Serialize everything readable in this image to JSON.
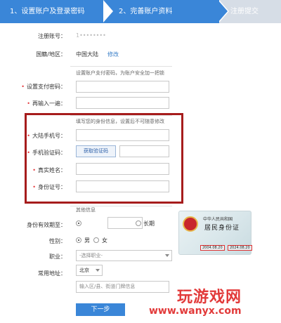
{
  "steps": {
    "step1": "1、设置账户及登录密码",
    "step2": "2、完善账户资料",
    "step3": "注册提交"
  },
  "account": {
    "label": "注册账号：",
    "value": "1••••••••",
    "region_label": "国籍/地区：",
    "region_value": "中国大陆",
    "region_link": "修改"
  },
  "pay_section": "设置账户支付密码，为账户安全加一把锁",
  "pay": {
    "password_label": "设置支付密码：",
    "confirm_label": "再输入一遍："
  },
  "identity_section": "填写您的身份信息，设置后不可随意修改",
  "identity": {
    "phone_label": "大陆手机号：",
    "sms_label": "手机验证码：",
    "sms_button": "获取验证码",
    "name_label": "真实姓名：",
    "id_label": "身份证号："
  },
  "other_section": "其他信息",
  "other": {
    "validity_label": "身份有效期至：",
    "longterm": "长期",
    "gender_label": "性别：",
    "male": "男",
    "female": "女",
    "job_label": "职业：",
    "job_placeholder": "-选择职业-",
    "address_label": "常用地址：",
    "city": "北京",
    "address_placeholder": "输入区/县、街道门牌信息"
  },
  "idcard": {
    "line1": "中华人民共和国",
    "line2": "居民身份证",
    "valid_from": "2004.08.20",
    "valid_to": "2024.08.20",
    "dash": "-"
  },
  "next_button": "下一步",
  "watermark": {
    "line1": "玩游戏网",
    "line2": "www.wanyx.com"
  },
  "colors": {
    "accent": "#3a86d8",
    "highlight_box": "#a61c1c",
    "required": "#e4393c"
  }
}
